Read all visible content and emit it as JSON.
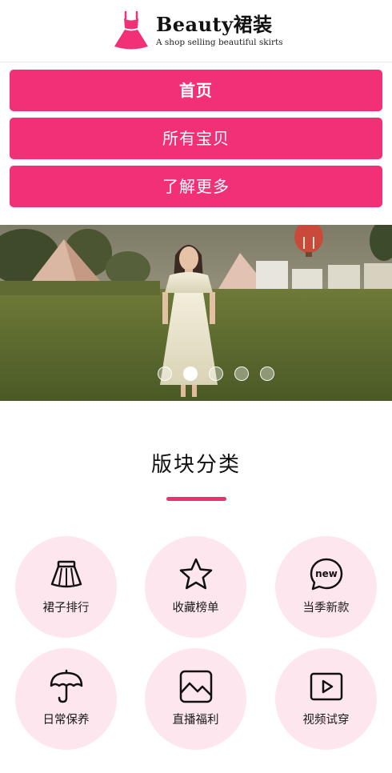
{
  "header": {
    "title": "Beauty裙装",
    "subtitle": "A shop selling beautiful skirts",
    "logo_icon": "dress-icon",
    "brand_color": "#f23078"
  },
  "nav": {
    "items": [
      {
        "label": "首页",
        "active": true
      },
      {
        "label": "所有宝贝",
        "active": false
      },
      {
        "label": "了解更多",
        "active": false
      }
    ]
  },
  "banner": {
    "slide_count": 5,
    "active_slide": 2
  },
  "section": {
    "title": "版块分类"
  },
  "categories": [
    {
      "label": "裙子排行",
      "icon": "skirt-icon"
    },
    {
      "label": "收藏榜单",
      "icon": "star-icon"
    },
    {
      "label": "当季新款",
      "icon": "new-bubble-icon",
      "icon_text": "new"
    },
    {
      "label": "日常保养",
      "icon": "umbrella-icon"
    },
    {
      "label": "直播福利",
      "icon": "image-icon"
    },
    {
      "label": "视频试穿",
      "icon": "video-play-icon"
    }
  ]
}
